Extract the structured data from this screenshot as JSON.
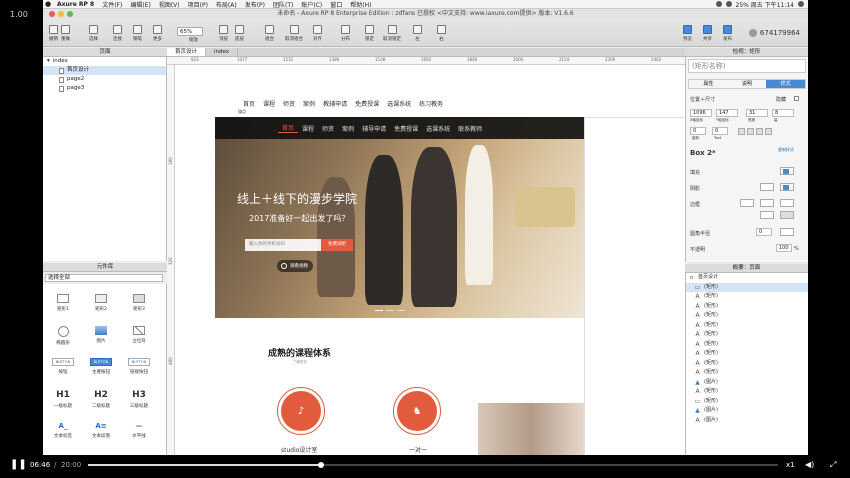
{
  "player": {
    "speed_top": "1.00",
    "current": "06:46",
    "total": "20:00",
    "rate": "x1",
    "progress_fraction": 0.338
  },
  "menubar": {
    "apple": "",
    "app": "Axure RP 8",
    "items": [
      "文件(F)",
      "编辑(E)",
      "视图(V)",
      "项目(P)",
      "布局(A)",
      "发布(P)",
      "团队(T)",
      "账户(C)",
      "窗口",
      "帮助(H)"
    ],
    "right_text": "25%  周五 下午11:14"
  },
  "titlebar": {
    "title": "未命名 - Axure RP 8 Enterprise Edition : zdfans 已授权     <中文支持: www.iaxure.com提供> 版本: V1.6.6"
  },
  "toolbar": {
    "buttons": [
      "撤销",
      "重做",
      "选择",
      "连接",
      "钢笔",
      "更多",
      "缩放",
      "顶层",
      "底层",
      "组合",
      "取消组合",
      "对齐",
      "分布",
      "锁定",
      "取消锁定",
      "左",
      "右",
      "预览",
      "共享",
      "发布"
    ],
    "zoom": "65%",
    "user": "674179964"
  },
  "pages_panel": {
    "title": "页面",
    "items": [
      {
        "label": "index",
        "type": "folder"
      },
      {
        "label": "首页设计",
        "type": "page",
        "selected": true
      },
      {
        "label": "page2",
        "type": "page"
      },
      {
        "label": "page3",
        "type": "page"
      }
    ]
  },
  "library_panel": {
    "title": "元件库",
    "select": "选择全部",
    "widgets": [
      {
        "label": "矩形1"
      },
      {
        "label": "矩形2"
      },
      {
        "label": "矩形3"
      },
      {
        "label": "椭圆形"
      },
      {
        "label": "图片"
      },
      {
        "label": "占位符"
      },
      {
        "label": "按钮",
        "tag": "BUTTON"
      },
      {
        "label": "主要按钮",
        "tag": "BUTTON"
      },
      {
        "label": "链接按钮",
        "tag": "BUTTON"
      },
      {
        "label": "一级标题",
        "tag": "H1"
      },
      {
        "label": "二级标题",
        "tag": "H2"
      },
      {
        "label": "三级标题",
        "tag": "H3"
      },
      {
        "label": "文本标签",
        "tag": "A_"
      },
      {
        "label": "文本段落",
        "tag": "A≡"
      },
      {
        "label": "水平线",
        "tag": "—"
      }
    ]
  },
  "tabs": [
    {
      "label": "首页设计",
      "active": true
    },
    {
      "label": "index",
      "active": false
    }
  ],
  "ruler_top": [
    "923",
    "1077",
    "1231",
    "1386",
    "1538",
    "1692",
    "1846",
    "2000",
    "2154",
    "2309",
    "2462"
  ],
  "ruler_left": [
    "180",
    "320",
    "480",
    "640"
  ],
  "canvas": {
    "nav_plain": [
      "首页",
      "课程",
      "师资",
      "案例",
      "教辅申请",
      "免费授课",
      "选课系统",
      "练习教务"
    ],
    "anchor_label": "锚点",
    "nav_dark": [
      "首页",
      "课程",
      "师资",
      "案例",
      "辅导申请",
      "免费授课",
      "选课系统",
      "联系教师"
    ],
    "hero_title": "线上＋线下的漫步学院",
    "hero_subtitle": "2017准备好一起出发了吗？",
    "search_placeholder": "输入你的手机号码",
    "signup_label": "免费试听",
    "watch_label": "观看视频",
    "section_title": "成熟的课程体系",
    "section_subtitle": "了解更多",
    "course1_label": "studio设计室",
    "course2_label": "一对一"
  },
  "inspector": {
    "title": "检视：矩形",
    "shape_name_placeholder": "(矩形名称)",
    "tabs": [
      "属性",
      "说明",
      "样式"
    ],
    "active_tab": "样式",
    "position_label": "位置＋尺寸",
    "hidden_label": "隐藏",
    "x": "1096",
    "y": "147",
    "w": "31",
    "h": "8",
    "x_label": "X轴坐标",
    "y_label": "Y轴坐标",
    "w_label": "宽度",
    "h_label": "高",
    "rot": "0",
    "text_rot": "0",
    "rot_label": "旋转",
    "text_label": "Text",
    "style": "Box 2*",
    "style_link": "更新样式",
    "fill_label": "填充",
    "shadow_label": "阴影",
    "border_label": "边框",
    "radius_label": "圆角半径",
    "radius_value": "0",
    "opacity_label": "不透明",
    "opacity_value": "100",
    "opacity_unit": "%",
    "accent_color": "#4a8ad4"
  },
  "outline_panel": {
    "title": "概要：页面",
    "root": "首页设计",
    "items": [
      {
        "icon": "rect",
        "label": "(矩形)",
        "selected": true
      },
      {
        "icon": "A",
        "label": "(矩形)"
      },
      {
        "icon": "A",
        "label": "(矩形)"
      },
      {
        "icon": "A",
        "label": "(矩形)"
      },
      {
        "icon": "A",
        "label": "(矩形)"
      },
      {
        "icon": "A",
        "label": "(矩形)"
      },
      {
        "icon": "A",
        "label": "(矩形)"
      },
      {
        "icon": "A",
        "label": "(矩形)"
      },
      {
        "icon": "A",
        "label": "(矩形)"
      },
      {
        "icon": "A",
        "label": "(矩形)"
      },
      {
        "icon": "image",
        "label": "(图片)"
      },
      {
        "icon": "A",
        "label": "(矩形)"
      },
      {
        "icon": "rect",
        "label": "(矩形)"
      },
      {
        "icon": "image",
        "label": "(图片)"
      },
      {
        "icon": "A",
        "label": "(图片)"
      }
    ]
  },
  "colors": {
    "brand_orange": "#e35b3d",
    "selection": "#d4e4f7"
  }
}
